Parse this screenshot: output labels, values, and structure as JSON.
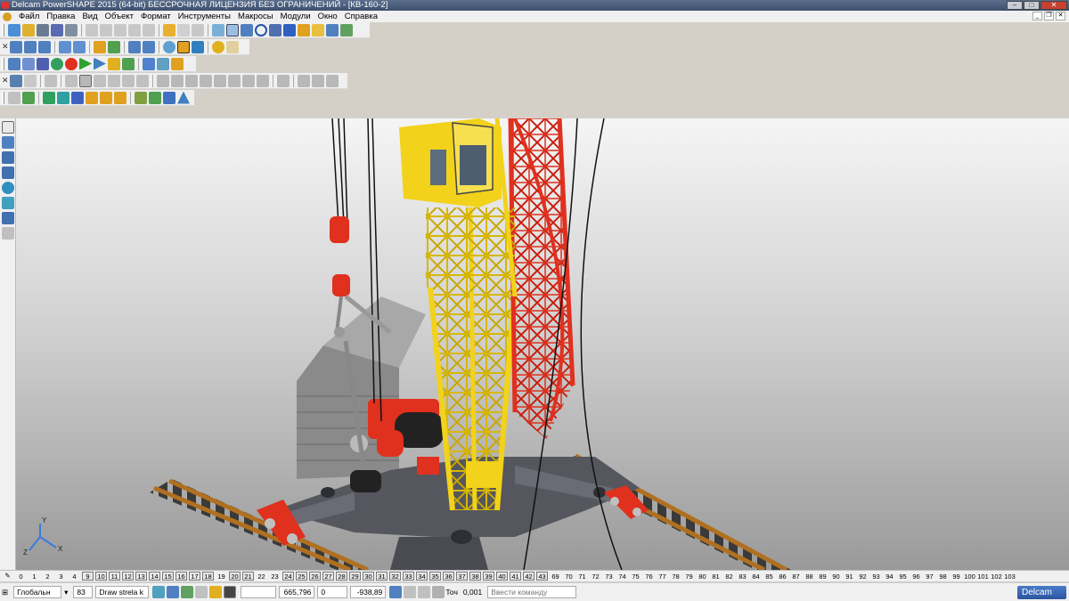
{
  "window": {
    "title": "Delcam PowerSHAPE 2015 (64-bit) БЕССРОЧНАЯ ЛИЦЕНЗИЯ БЕЗ ОГРАНИЧЕНИЙ - [КВ-160-2]"
  },
  "menu": [
    "Файл",
    "Правка",
    "Вид",
    "Объект",
    "Формат",
    "Инструменты",
    "Макросы",
    "Модули",
    "Окно",
    "Справка"
  ],
  "axes": {
    "x": "X",
    "y": "Y",
    "z": "Z"
  },
  "levels": [
    "0",
    "1",
    "2",
    "3",
    "4",
    "9",
    "10",
    "11",
    "12",
    "13",
    "14",
    "15",
    "16",
    "17",
    "18",
    "19",
    "20",
    "21",
    "22",
    "23",
    "24",
    "25",
    "26",
    "27",
    "28",
    "29",
    "30",
    "31",
    "32",
    "33",
    "34",
    "35",
    "36",
    "37",
    "38",
    "39",
    "40",
    "41",
    "42",
    "43",
    "69",
    "70",
    "71",
    "72",
    "73",
    "74",
    "75",
    "76",
    "77",
    "78",
    "79",
    "80",
    "81",
    "82",
    "83",
    "84",
    "85",
    "86",
    "87",
    "88",
    "89",
    "90",
    "91",
    "92",
    "93",
    "94",
    "95",
    "96",
    "97",
    "98",
    "99",
    "100",
    "101",
    "102",
    "103"
  ],
  "status": {
    "workplane": "Глобальн",
    "level_number": "83",
    "level_name": "Draw strela k",
    "coord_x": "665,796",
    "coord_y": "0",
    "coord_z": "-938,89",
    "tolerance_label": "Точ",
    "tolerance_value": "0,001",
    "command_placeholder": "Ввести команду"
  },
  "brand": "Delcam",
  "colors": {
    "viewport_top": "#f5f5f5",
    "viewport_bottom": "#9a9a9a",
    "crane_yellow": "#f2d21a",
    "crane_red": "#e0301e",
    "metal_gray": "#55565e"
  }
}
